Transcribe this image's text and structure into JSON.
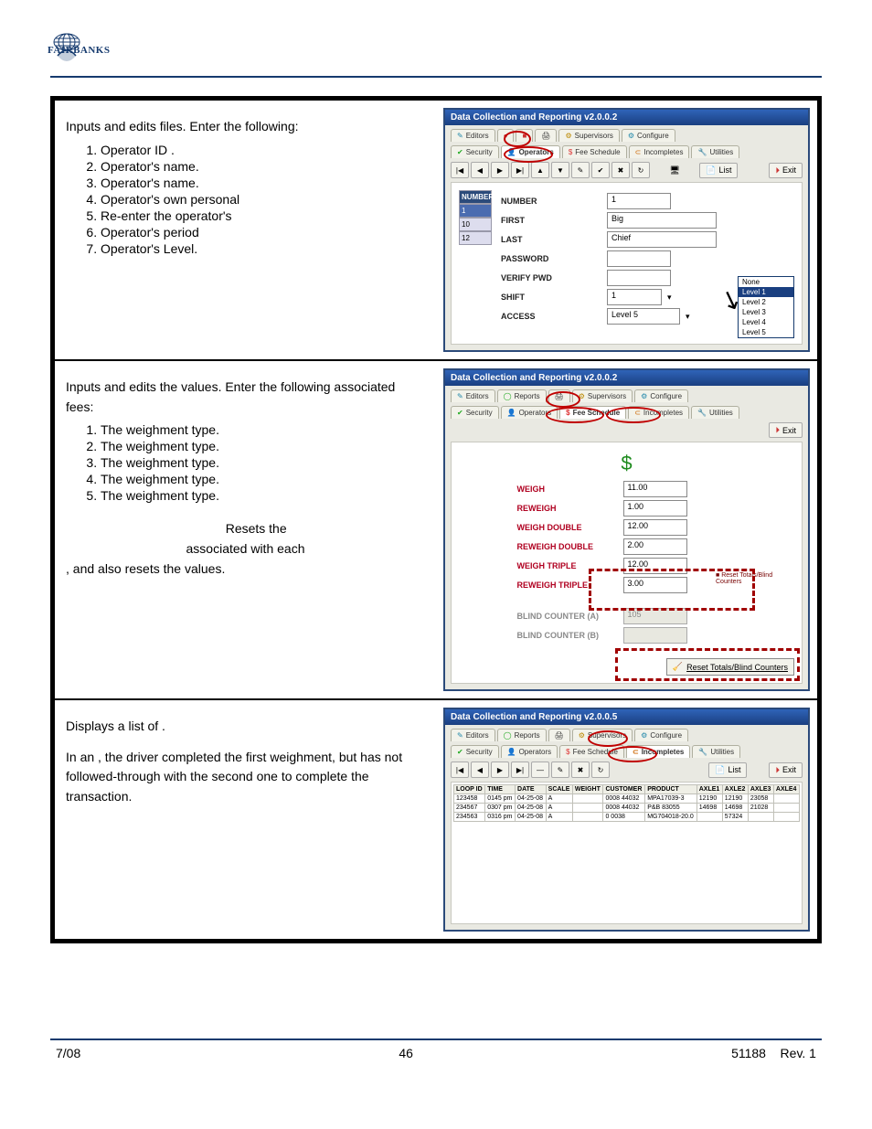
{
  "logo_text": "FAIRBANKS",
  "top_rule": true,
  "section1": {
    "intro_1a": "Inputs and edits ",
    "intro_1b": " files. Enter the following:",
    "items": [
      "Operator ID            .",
      "Operator's            name.",
      "Operator's            name.",
      "Operator's own personal",
      "Re-enter the operator's",
      "Operator's            period",
      "Operator's            Level."
    ]
  },
  "shot1": {
    "title": "Data Collection and Reporting   v2.0.0.2",
    "tabs_row1": [
      "Editors",
      "",
      "",
      "",
      "Supervisors",
      "Configure"
    ],
    "tabs_row2": [
      "Security",
      "Operators",
      "Fee Schedule",
      "Incompletes",
      "Utilities"
    ],
    "toolbar_buttons": [
      "|◀",
      "◀",
      "▶",
      "▶|",
      "▲",
      "▼",
      "✎",
      "✔",
      "✖",
      "↻"
    ],
    "list_btn": "List",
    "exit_btn": "Exit",
    "numcol_header": "NUMBER",
    "numcol_values": [
      "1",
      "10",
      "12"
    ],
    "fields": {
      "NUMBER": "1",
      "FIRST": "Big",
      "LAST": "Chief",
      "PASSWORD": "",
      "VERIFY PWD": "",
      "SHIFT": "1",
      "ACCESS": "Level 5"
    },
    "access_options": [
      "None",
      "Level 1",
      "Level 2",
      "Level 3",
      "Level 4",
      "Level 5"
    ],
    "access_selected": "Level 1"
  },
  "section2": {
    "intro_a": "Inputs and edits the ",
    "intro_b": " values.  Enter the following associated fees:",
    "items": [
      "The                 weighment type.",
      "The                        weighment type.",
      "The                                 weighment type.",
      "The                        weighment type.",
      "The                                 weighment type."
    ],
    "reset_intro_a": "Resets the ",
    "reset_intro_b": " associated with each ",
    "reset_intro_c": ", and also resets the ",
    "reset_intro_d": " values."
  },
  "shot2": {
    "title": "Data Collection and Reporting   v2.0.0.2",
    "tabs_row1": [
      "Editors",
      "Reports",
      "",
      "Supervisors",
      "Configure"
    ],
    "tabs_row2": [
      "Security",
      "Operators",
      "Fee Schedule",
      "Incompletes",
      "Utilities"
    ],
    "exit_btn": "Exit",
    "dollar": "$",
    "fields": {
      "WEIGH": "11.00",
      "REWEIGH": "1.00",
      "WEIGH DOUBLE": "12.00",
      "REWEIGH DOUBLE": "2.00",
      "WEIGH TRIPLE": "12.00",
      "REWEIGH TRIPLE": "3.00"
    },
    "readonly": {
      "BLIND COUNTER (A)": "105",
      "BLIND COUNTER (B)": ""
    },
    "ro_side_label": "Reset Totals/Blind Counters",
    "reset_button": "Reset Totals/Blind Counters"
  },
  "section3": {
    "line1_a": "Displays a list of ",
    "line1_b": ".",
    "line2_a": "In an ",
    "line2_b": ", the driver completed the first weighment, but has not followed-through with the second one to complete the transaction."
  },
  "shot3": {
    "title": "Data Collection and Reporting   v2.0.0.5",
    "tabs_row1": [
      "Editors",
      "Reports",
      "",
      "Supervisors",
      "Configure"
    ],
    "tabs_row2": [
      "Security",
      "Operators",
      "Fee Schedule",
      "Incompletes",
      "Utilities"
    ],
    "toolbar_buttons": [
      "|◀",
      "◀",
      "▶",
      "▶|",
      "—",
      "✎",
      "✖",
      "↻"
    ],
    "list_btn": "List",
    "exit_btn": "Exit",
    "columns": [
      "LOOP ID",
      "TIME",
      "DATE",
      "SCALE",
      "WEIGHT",
      "CUSTOMER",
      "PRODUCT",
      "AXLE1",
      "AXLE2",
      "AXLE3",
      "AXLE4"
    ],
    "rows": [
      [
        "123458",
        "0145 pm",
        "04-25-08",
        "A",
        "",
        "0008 44032",
        "MPA17039-3",
        "12190",
        "12190",
        "23058",
        ""
      ],
      [
        "234567",
        "0307 pm",
        "04-25-08",
        "A",
        "",
        "0008 44032",
        "P&B 83055",
        "14698",
        "14698",
        "21028",
        ""
      ],
      [
        "234563",
        "0316 pm",
        "04-25-08",
        "A",
        "",
        "0 0038",
        "MG704018-20.0",
        "",
        "57324",
        "",
        ""
      ]
    ]
  },
  "footer": {
    "left": "7/08",
    "center": "46",
    "right_a": "51188",
    "right_b": "Rev. 1"
  }
}
